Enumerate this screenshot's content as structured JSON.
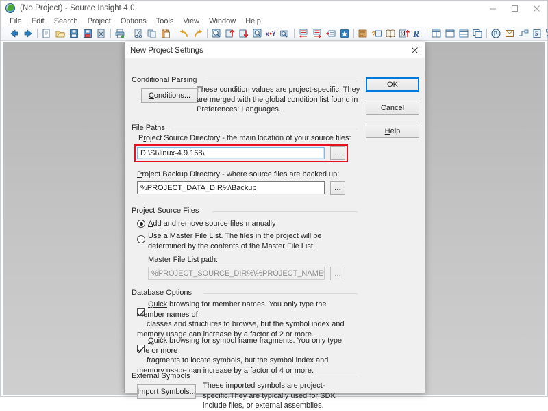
{
  "window": {
    "title": "(No Project) - Source Insight 4.0",
    "icon": "source-insight-icon",
    "minimize_label": "—",
    "maximize_label": "☐",
    "close_label": "✕"
  },
  "menubar": {
    "items": [
      {
        "label": "File"
      },
      {
        "label": "Edit"
      },
      {
        "label": "Search"
      },
      {
        "label": "Project"
      },
      {
        "label": "Options"
      },
      {
        "label": "Tools"
      },
      {
        "label": "View"
      },
      {
        "label": "Window"
      },
      {
        "label": "Help"
      }
    ]
  },
  "toolbar": {
    "groups": [
      [
        "back-icon",
        "forward-icon"
      ],
      [
        "new-file-icon",
        "open-file-icon",
        "save-icon",
        "save-all-icon",
        "close-file-icon"
      ],
      [
        "print-icon"
      ],
      [
        "cut-icon",
        "copy-icon",
        "paste-icon"
      ],
      [
        "undo-icon",
        "redo-icon"
      ],
      [
        "lookup-reference-icon",
        "jump-up-icon",
        "jump-down-icon",
        "search-file-icon",
        "replace-icon",
        "search-project-icon"
      ],
      [
        "indent-left-icon",
        "indent-right-icon",
        "comment-icon",
        "bookmark-icon"
      ],
      [
        "symbol-window-icon",
        "context-window-icon",
        "relation-window-icon",
        "project-window-icon",
        "smart-rename-icon"
      ],
      [
        "tile-window-icon",
        "cascade-window-icon",
        "split-window-icon",
        "duplicate-window-icon"
      ],
      [
        "parse-icon",
        "clip-window-icon",
        "outline-icon",
        "syntax-icon",
        "refactor-icon"
      ]
    ]
  },
  "dialog": {
    "title": "New Project Settings",
    "close_label": "✕",
    "buttons": {
      "ok": "OK",
      "cancel": "Cancel",
      "help": "Help"
    },
    "conditional_parsing": {
      "group_label": "Conditional Parsing",
      "button": "Conditions...",
      "description": "These condition values are project-specific.  They are merged with the global condition list found in Preferences: Languages."
    },
    "file_paths": {
      "group_label": "File Paths",
      "source_dir_label": "Project Source Directory - the main location of your source files:",
      "source_dir_value": "D:\\SI\\linux-4.9.168\\",
      "source_dir_browse": "...",
      "backup_dir_label": "Project Backup Directory - where source files are backed up:",
      "backup_dir_value": "%PROJECT_DATA_DIR%\\Backup",
      "backup_dir_browse": "...",
      "highlight_color": "#e81123"
    },
    "project_source_files": {
      "group_label": "Project Source Files",
      "option_manual": "Add and remove source files manually",
      "option_manual_selected": true,
      "option_master": "Use a Master File List. The files in the project will be determined by the contents of the Master File List.",
      "option_master_selected": false,
      "master_path_label": "Master File List path:",
      "master_path_value": "%PROJECT_SOURCE_DIR%\\%PROJECT_NAME%_filelist.txt",
      "master_path_browse": "..."
    },
    "database_options": {
      "group_label": "Database Options",
      "option1_checked": true,
      "option1_text": "Quick browsing for member names.  You only type the member names of classes and structures to browse, but the symbol index and memory usage can increase by a factor of 2 or more.",
      "option2_checked": true,
      "option2_text": "Quick browsing for symbol name fragments.  You only type one or more fragments to locate symbols, but the symbol index and memory usage can increase by a factor of 4 or more."
    },
    "external_symbols": {
      "group_label": "External Symbols",
      "button": "Import Symbols...",
      "description": "These imported symbols are project-specific.They are typically used for SDK include files, or external assemblies."
    }
  }
}
